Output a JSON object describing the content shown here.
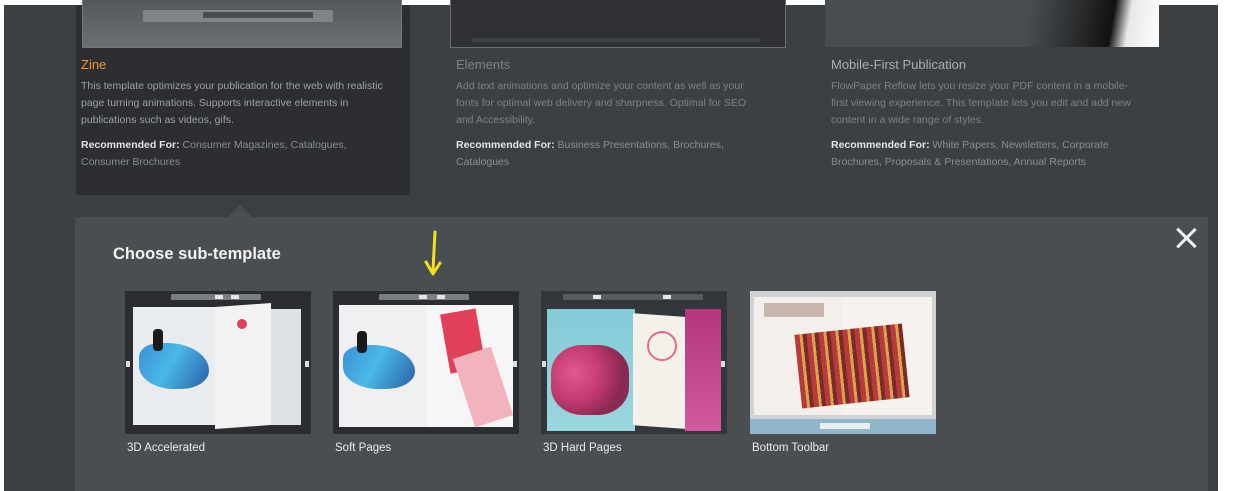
{
  "templates": [
    {
      "title": "Zine",
      "title_color": "#f39a2b",
      "description": "This template optimizes your publication for the web with realistic page turning animations. Supports interactive elements in publications such as videos, gifs.",
      "recommended_label": "Recommended For:",
      "recommended": "Consumer Magazines, Catalogues, Consumer Brochures",
      "selected": true
    },
    {
      "title": "Elements",
      "title_color": "#7f8387",
      "description": "Add text animations and optimize your content as well as your fonts for optimal web delivery and sharpness. Optimal for SEO and Accessibility.",
      "recommended_label": "Recommended For:",
      "recommended": "Business Presentations, Brochures, Catalogues",
      "selected": false
    },
    {
      "title": "Mobile-First Publication",
      "title_color": "#a9adb1",
      "description": "FlowPaper Reflow lets you resize your PDF content in a mobile-first viewing experience. This template lets you edit and add new content in a wide range of styles.",
      "recommended_label": "Recommended For:",
      "recommended": "White Papers, Newsletters, Corporate Brochures, Proposals & Presentations, Annual Reports",
      "selected": false
    }
  ],
  "panel": {
    "title": "Choose sub-template",
    "close_icon": "close-icon",
    "sub_templates": [
      {
        "label": "3D Accelerated"
      },
      {
        "label": "Soft Pages"
      },
      {
        "label": "3D Hard Pages"
      },
      {
        "label": "Bottom Toolbar"
      }
    ]
  },
  "annotation": {
    "icon": "arrow-down-icon",
    "color": "#f2e21f"
  },
  "colors": {
    "background": "#3d4043",
    "panel": "#4b4e51",
    "selected_card": "#2c2e31",
    "accent": "#f39a2b"
  }
}
